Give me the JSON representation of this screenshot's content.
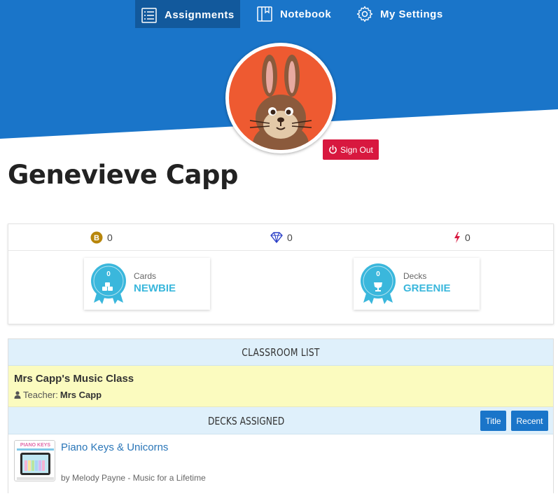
{
  "nav": {
    "items": [
      {
        "label": "Assignments",
        "icon": "list-icon",
        "active": true
      },
      {
        "label": "Notebook",
        "icon": "notebook-icon",
        "active": false
      },
      {
        "label": "My Settings",
        "icon": "gear-icon",
        "active": false
      }
    ]
  },
  "profile": {
    "name": "Genevieve Capp",
    "avatar_icon": "rabbit-avatar-icon",
    "sign_out_label": "Sign Out"
  },
  "stats": {
    "coins": "0",
    "gems": "0",
    "energy": "0"
  },
  "badges": [
    {
      "count": "0",
      "label": "Cards",
      "level": "NEWBIE",
      "icon": "cards-icon"
    },
    {
      "count": "0",
      "label": "Decks",
      "level": "GREENIE",
      "icon": "trophy-icon"
    }
  ],
  "classroom": {
    "header": "CLASSROOM LIST",
    "class_name": "Mrs Capp's Music Class",
    "teacher_label": "Teacher:",
    "teacher_name": "Mrs Capp"
  },
  "decks": {
    "header": "DECKS ASSIGNED",
    "sort_title_label": "Title",
    "sort_recent_label": "Recent",
    "items": [
      {
        "title": "Piano Keys & Unicorns",
        "author": "by Melody Payne - Music for a Lifetime",
        "thumb_text": "PIANO KEYS"
      }
    ]
  },
  "colors": {
    "nav": "#1a75c9",
    "sign_out": "#d8183f",
    "badge": "#3ab7dc",
    "class_row": "#fbfbbf",
    "header_bg": "#dff0fb"
  }
}
